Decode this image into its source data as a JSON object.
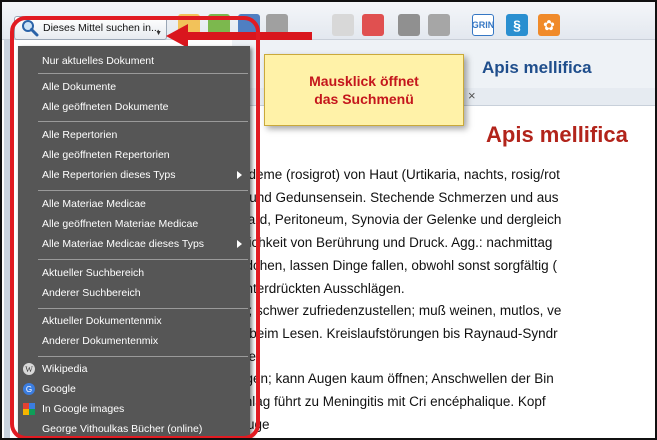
{
  "search_button": {
    "label": "Dieses Mittel suchen in..."
  },
  "toolbar_icons": [
    {
      "name": "vial-icon",
      "color": "#e8a33a"
    },
    {
      "name": "plant-icon",
      "color": "#5a9c3a"
    },
    {
      "name": "book-icon",
      "color": "#3a66a8"
    },
    {
      "name": "cup-icon",
      "color": "#8a8a8a"
    },
    {
      "name": "pin-icon",
      "color": "#b9b9b9"
    },
    {
      "name": "circle-icon",
      "color": "#cfcfcf"
    },
    {
      "name": "flag-icon",
      "color": "#d33"
    },
    {
      "name": "person-icon",
      "color": "#777"
    },
    {
      "name": "grin-icon",
      "color": "#3577c4",
      "text": "GRIN"
    },
    {
      "name": "snake-icon",
      "color": "#2a8fd0"
    },
    {
      "name": "flower-icon",
      "color": "#f08a2a"
    }
  ],
  "callout": {
    "line1": "Mausklick öffnet",
    "line2": "das Suchmenü"
  },
  "document": {
    "header_title": "Apis mellifica",
    "big_title": "Apis mellifica",
    "lines": [
      "Ödeme (rosigrot) von Haut (Urtikaria, nachts, rosig/rot",
      "g und Gedunsensein. Stechende Schmerzen und aus",
      "ikard, Peritoneum, Synovia der Gelenke und dergleich",
      "glichkeit von Berührung und Druck. Agg.: nachmittag",
      "ädchen, lassen Dinge fallen, obwohl sonst sorgfältig (",
      " unterdrückten Ausschlägen.",
      "ig; schwer zufriedenzustellen; muß weinen, mutlos, ve",
      "n beim Lesen. Kreislaufstörungen bis Raynaud-Syndr",
      "tze.",
      "ugen; kann Augen kaum öffnen; Anschwellen der Bin",
      "chlag führt zu Meningitis mit Cri encéphalique. Kopf",
      "Auge"
    ]
  },
  "menu": {
    "groups": [
      [
        "Nur aktuelles Dokument"
      ],
      [
        "Alle Dokumente",
        "Alle geöffneten Dokumente"
      ],
      [
        "Alle Repertorien",
        "Alle geöffneten Repertorien",
        "Alle Repertorien dieses Typs"
      ],
      [
        "Alle Materiae Medicae",
        "Alle geöffneten Materiae Medicae",
        "Alle Materiae Medicae dieses Typs"
      ],
      [
        "Aktueller Suchbereich",
        "Anderer Suchbereich"
      ],
      [
        "Aktueller Dokumentenmix",
        "Anderer Dokumentenmix"
      ],
      [
        "Wikipedia",
        "Google",
        "In Google images",
        "George Vithoulkas Bücher (online)"
      ]
    ]
  }
}
